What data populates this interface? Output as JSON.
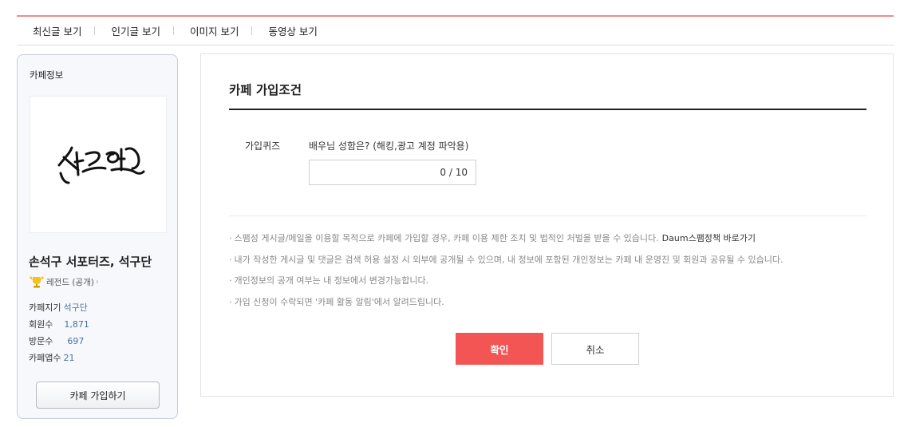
{
  "topnav": {
    "items": [
      "최신글 보기",
      "인기글 보기",
      "이미지 보기",
      "동영상 보기"
    ]
  },
  "sidebar": {
    "title": "카페정보",
    "cafe_name": "손석구 서포터즈, 석구단",
    "grade": "레전드 (공개)",
    "stats": {
      "manager_label": "카페지기",
      "manager_value": "석구단",
      "members_label": "회원수",
      "members_value": "1,871",
      "visits_label": "방문수",
      "visits_value": "697",
      "app_label": "카페앱수",
      "app_value": "21"
    },
    "join_button": "카페 가입하기"
  },
  "main": {
    "title": "카페 가입조건",
    "quiz_label": "가입퀴즈",
    "quiz_question": "배우님 성함은? (해킹,광고 계정 파악용)",
    "quiz_value": "",
    "quiz_counter": "0 / 10",
    "notices": [
      "스팸성 게시글/메일을 이용할 목적으로 카페에 가입할 경우, 카페 이용 제한 조치 및 법적인 처벌을 받을 수 있습니다.",
      "내가 작성한 게시글 및 댓글은 검색 허용 설정 시 외부에 공개될 수 있으며, 내 정보에 포함된 개인정보는 카페 내 운영진 및 회원과 공유될 수 있습니다.",
      "개인정보의 공개 여부는 내 정보에서 변경가능합니다.",
      "가입 신청이 수락되면 '카페 활동 알림'에서 알려드립니다."
    ],
    "notice_link": "Daum스팸정책 바로가기",
    "bullet": "·",
    "confirm": "확인",
    "cancel": "취소"
  },
  "colors": {
    "accent": "#f35454",
    "top_line": "#ec8f86",
    "stat_value": "#4b6fa8"
  }
}
